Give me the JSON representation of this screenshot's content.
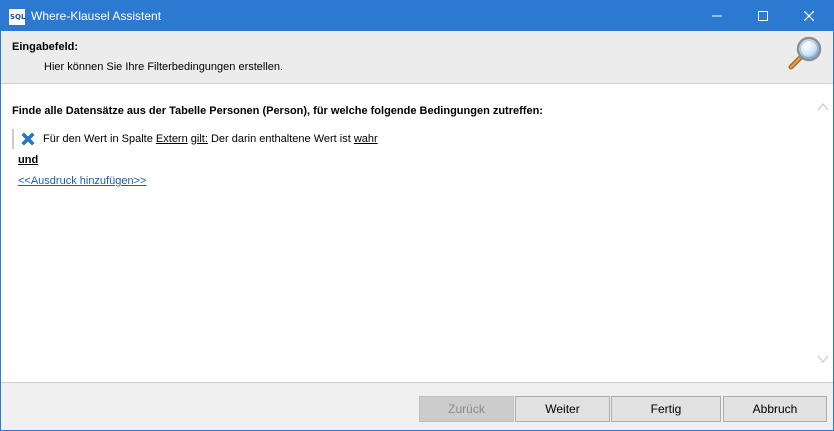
{
  "window": {
    "title": "Where-Klausel Assistent",
    "app_icon_text": "SQL",
    "minimize": "minimize",
    "maximize": "maximize",
    "close": "close"
  },
  "header": {
    "label": "Eingabefeld:",
    "description": "Hier können Sie Ihre Filterbedingungen erstellen.",
    "icon": "magnifier-icon"
  },
  "content": {
    "intro": "Finde alle Datensätze aus der Tabelle Personen (Person), für welche folgende Bedingungen zutreffen:",
    "condition": {
      "prefix": "Für den Wert in Spalte",
      "column": "Extern",
      "operator": "gilt:",
      "middle": "Der darin enthaltene Wert ist",
      "value": "wahr",
      "remove_icon": "remove-x-icon"
    },
    "connector": "und",
    "add_link": "<<Ausdruck hinzufügen>>"
  },
  "footer": {
    "back": "Zurück",
    "next": "Weiter",
    "finish": "Fertig",
    "cancel": "Abbruch"
  },
  "colors": {
    "titlebar": "#2b79d0",
    "link": "#1a5ea8",
    "remove_icon": "#1e7fc7"
  }
}
